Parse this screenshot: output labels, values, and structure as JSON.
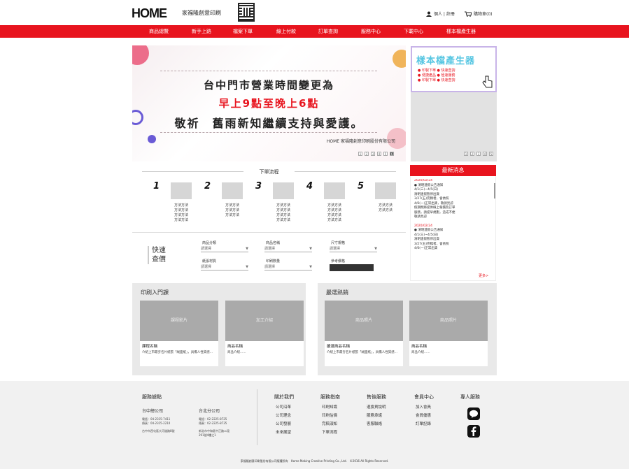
{
  "header": {
    "logo_word": "HOME",
    "logo_sub": "家福隆創意印刷",
    "login": "個人 | 註冊",
    "cart": "購物車(0)"
  },
  "nav": [
    "商品總覽",
    "新手上路",
    "檔案下單",
    "線上付款",
    "訂單查詢",
    "服務中心",
    "下載中心",
    "樣本檔產生器"
  ],
  "banner": {
    "line1": "台中門市營業時間變更為",
    "line2": "早上9點至晚上6點",
    "line3": "敬祈　舊雨新知繼續支持與愛護。",
    "company": "HOME 家福隆創意印刷股份有限公司",
    "pages": [
      "1",
      "2",
      "3",
      "4",
      "5",
      "6"
    ]
  },
  "side_ad": {
    "title": "樣本檔產生器",
    "lines": [
      "● 印製下單  ● 快速查詢",
      "● 便捷產品  ● 極速服務",
      "● 印製下單  ● 快速查詢"
    ],
    "pages": [
      "1",
      "2",
      "3",
      "4",
      "5"
    ]
  },
  "flow": {
    "title": "下單流程",
    "steps": [
      {
        "n": "1",
        "text": "方法方法\n方法方法\n方法方法\n方法方法"
      },
      {
        "n": "2",
        "text": "方法方法\n方法方法\n方法方法"
      },
      {
        "n": "3",
        "text": "方法方法\n方法方法\n方法方法\n方法方法"
      },
      {
        "n": "4",
        "text": "方法方法\n方法方法\n方法方法\n方法方法"
      },
      {
        "n": "5",
        "text": "方法方法\n方法方法"
      }
    ]
  },
  "quick": {
    "title": "快速\n查價",
    "f1_label": "商品分類",
    "f1_value": "請選擇",
    "f2_label": "商品名稱",
    "f2_value": "請選擇",
    "f3_label": "尺寸規格",
    "f3_value": "請選擇",
    "f4_label": "紙張材質",
    "f4_value": "請選擇",
    "f5_label": "印刷數量",
    "f5_value": "請選擇",
    "f6_label": "參考價格"
  },
  "news": {
    "title": "最新消息",
    "items": [
      {
        "date": "2020/02/24",
        "text": "● 清明連假公告通知\n4/1(三)~4/5(日)\n清明連假暫停出貨\n3/27(五)完稿者，會依照\n4/6(一)正常出貨，敬請見諒\n假期間將提供線上報價及訂單\n服務，請提早規劃，造成不便\n敬請見諒"
      },
      {
        "date": "2020/02/24",
        "text": "● 清明連假公告通知\n4/1(三)~4/5(日)\n清明連假暫停出貨\n3/27(五)完稿者，會依照\n4/6(一)正常出貨"
      }
    ],
    "more": "更多>"
  },
  "sections": [
    {
      "title": "印刷入門課",
      "cards": [
        {
          "img": "課程影片",
          "name": "課程名稱",
          "desc": "介紹上市最夯名片紙張「絨面紙」，具備人性質感..."
        },
        {
          "img": "加工介紹",
          "name": "商品名稱",
          "desc": "商品介紹......"
        }
      ]
    },
    {
      "title": "嚴選熱銷",
      "cards": [
        {
          "img": "商品照片",
          "name": "嚴選商品名稱",
          "desc": "介紹上市最夯名片紙張「絨面紙」，具備人性質感..."
        },
        {
          "img": "商品照片",
          "name": "商品名稱",
          "desc": "商品介紹......"
        }
      ]
    }
  ],
  "footer": {
    "service_title": "服務據點",
    "taichung": {
      "name": "台中總公司",
      "tel": "電話：04-2315-7411",
      "fax": "傳真：04-2315-2210",
      "addr": "台中市西屯區大河道路8號"
    },
    "taipei": {
      "name": "台北分公司",
      "tel": "電話：02-2225-8725",
      "fax": "傳真：02-2225-8735",
      "addr": "新北市中和區中正路二段",
      "addr2": "291號4樓之1"
    },
    "cols": [
      {
        "title": "關於我們",
        "links": [
          "公司沿革",
          "公司理念",
          "公司發展",
          "未來展望"
        ]
      },
      {
        "title": "服務指南",
        "links": [
          "印刷知識",
          "印刷估價",
          "完稿須知",
          "下單流程"
        ]
      },
      {
        "title": "售後服務",
        "links": [
          "退換貨說明",
          "服務承諾",
          "客服聯絡"
        ]
      },
      {
        "title": "會員中心",
        "links": [
          "加入會員",
          "會員優惠",
          "訂單記錄"
        ]
      }
    ],
    "social_title": "專人服務",
    "copyright": "家福隆創意印刷股份有限公司版權所有　Home Making Creative Printing Co., Ltd.　©2016 All Rights Reserved."
  },
  "colors": {
    "brand_red": "#e8141e",
    "footer_bg": "#f1f1f1"
  }
}
